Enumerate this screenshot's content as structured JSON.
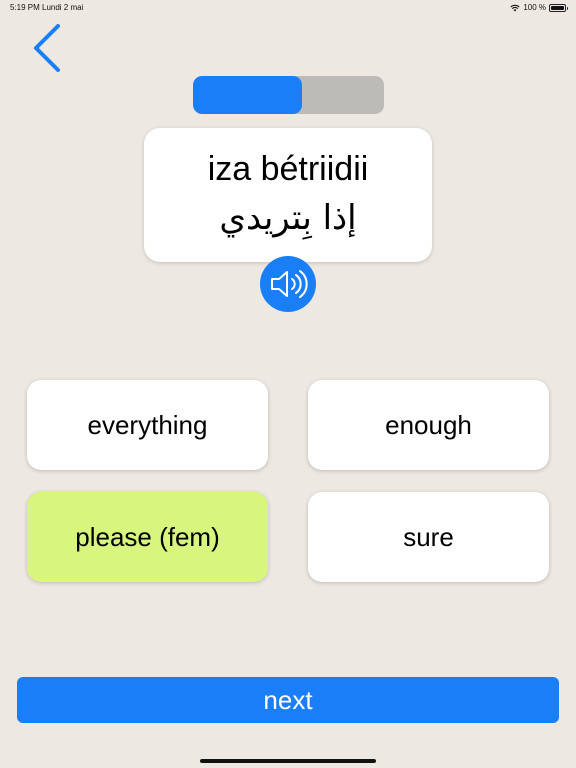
{
  "status_bar": {
    "time": "5:19 PM",
    "date": "Lundi 2 mai",
    "battery": "100 %",
    "icons": [
      "wifi-icon",
      "battery-icon"
    ]
  },
  "nav": {
    "back_icon": "chevron-left-icon"
  },
  "progress": {
    "fraction": 0.57,
    "fill_color": "#1A7EF6",
    "track_color": "#BDBBB8"
  },
  "prompt": {
    "transliteration": "iza bétriidii",
    "arabic": "إذا بِتريدي",
    "audio_icon": "speaker-icon"
  },
  "options": [
    {
      "label": "everything",
      "selected": false
    },
    {
      "label": "enough",
      "selected": false
    },
    {
      "label": "please (fem)",
      "selected": true
    },
    {
      "label": "sure",
      "selected": false
    }
  ],
  "next_button": {
    "label": "next"
  },
  "colors": {
    "accent": "#1A7EF6",
    "selected": "#D8F57E",
    "background": "#EDE8E2"
  }
}
